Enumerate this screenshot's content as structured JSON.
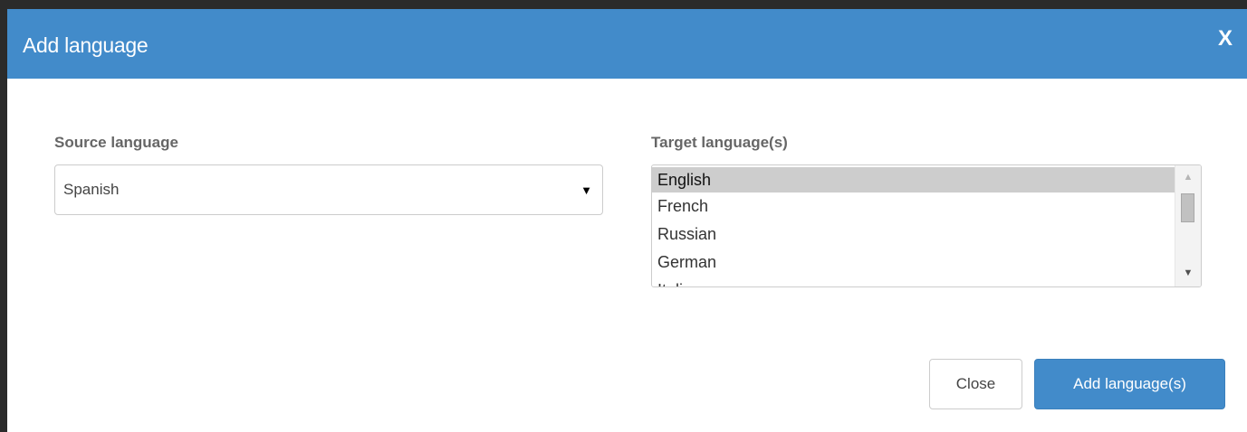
{
  "dialog": {
    "title": "Add language",
    "close_glyph": "X"
  },
  "source": {
    "label": "Source language",
    "selected": "Spanish",
    "caret": "▼"
  },
  "target": {
    "label": "Target language(s)",
    "options": [
      "English",
      "French",
      "Russian",
      "German",
      "Italian"
    ],
    "selected": "English",
    "scroll_up": "▲",
    "scroll_down": "▼"
  },
  "buttons": {
    "close_label": "Close",
    "add_label": "Add language(s)"
  },
  "colors": {
    "header": "#428bca",
    "primary_button": "#428bca",
    "selected_option": "#cdcdcd"
  }
}
